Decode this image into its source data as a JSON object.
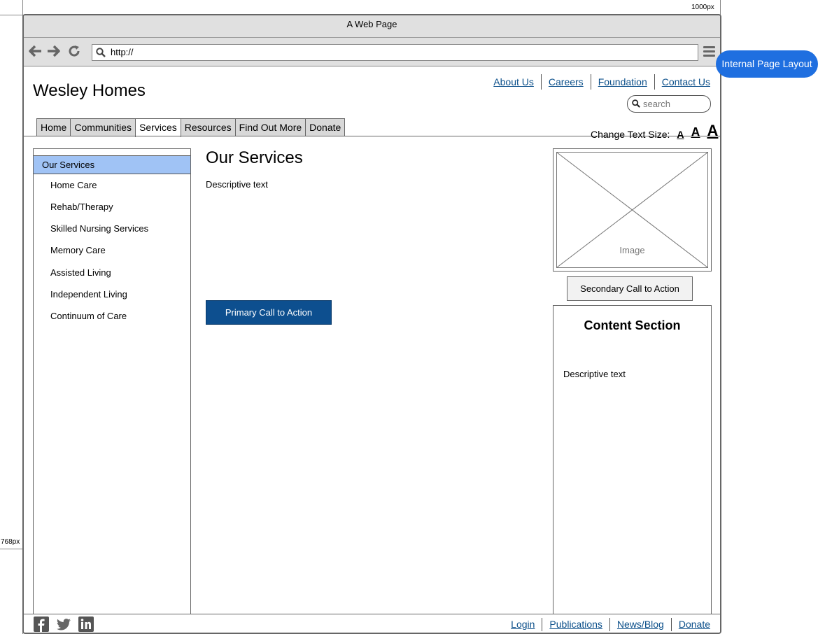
{
  "rulers": {
    "width_label": "1000px",
    "height_label": "768px"
  },
  "window": {
    "title": "A Web Page",
    "url": "http://"
  },
  "header": {
    "site_title": "Wesley Homes",
    "util_links": [
      "About Us",
      "Careers",
      "Foundation",
      "Contact Us"
    ],
    "search_placeholder": "search",
    "tabs": [
      "Home",
      "Communities",
      "Services",
      "Resources",
      "Find Out More",
      "Donate"
    ],
    "active_tab": "Services",
    "text_size_label": "Change Text Size:",
    "text_size_glyph": "A"
  },
  "sidebar": {
    "active_item": "Our Services",
    "items": [
      "Home Care",
      "Rehab/Therapy",
      "Skilled Nursing Services",
      "Memory Care",
      "Assisted Living",
      "Independent Living",
      "Continuum of Care"
    ]
  },
  "main": {
    "heading": "Our Services",
    "description": "Descriptive text",
    "primary_cta": "Primary Call to Action"
  },
  "aside": {
    "image_label": "Image",
    "secondary_cta": "Secondary Call to Action",
    "content_title": "Content Section",
    "content_description": "Descriptive text"
  },
  "footer": {
    "links": [
      "Login",
      "Publications",
      "News/Blog",
      "Donate"
    ]
  },
  "annotation": {
    "label": "Internal Page Layout"
  },
  "colors": {
    "accent": "#0d4f8f",
    "active_nav": "#a0c3f5",
    "callout": "#1f6fe0",
    "link": "#0b4f8a"
  }
}
